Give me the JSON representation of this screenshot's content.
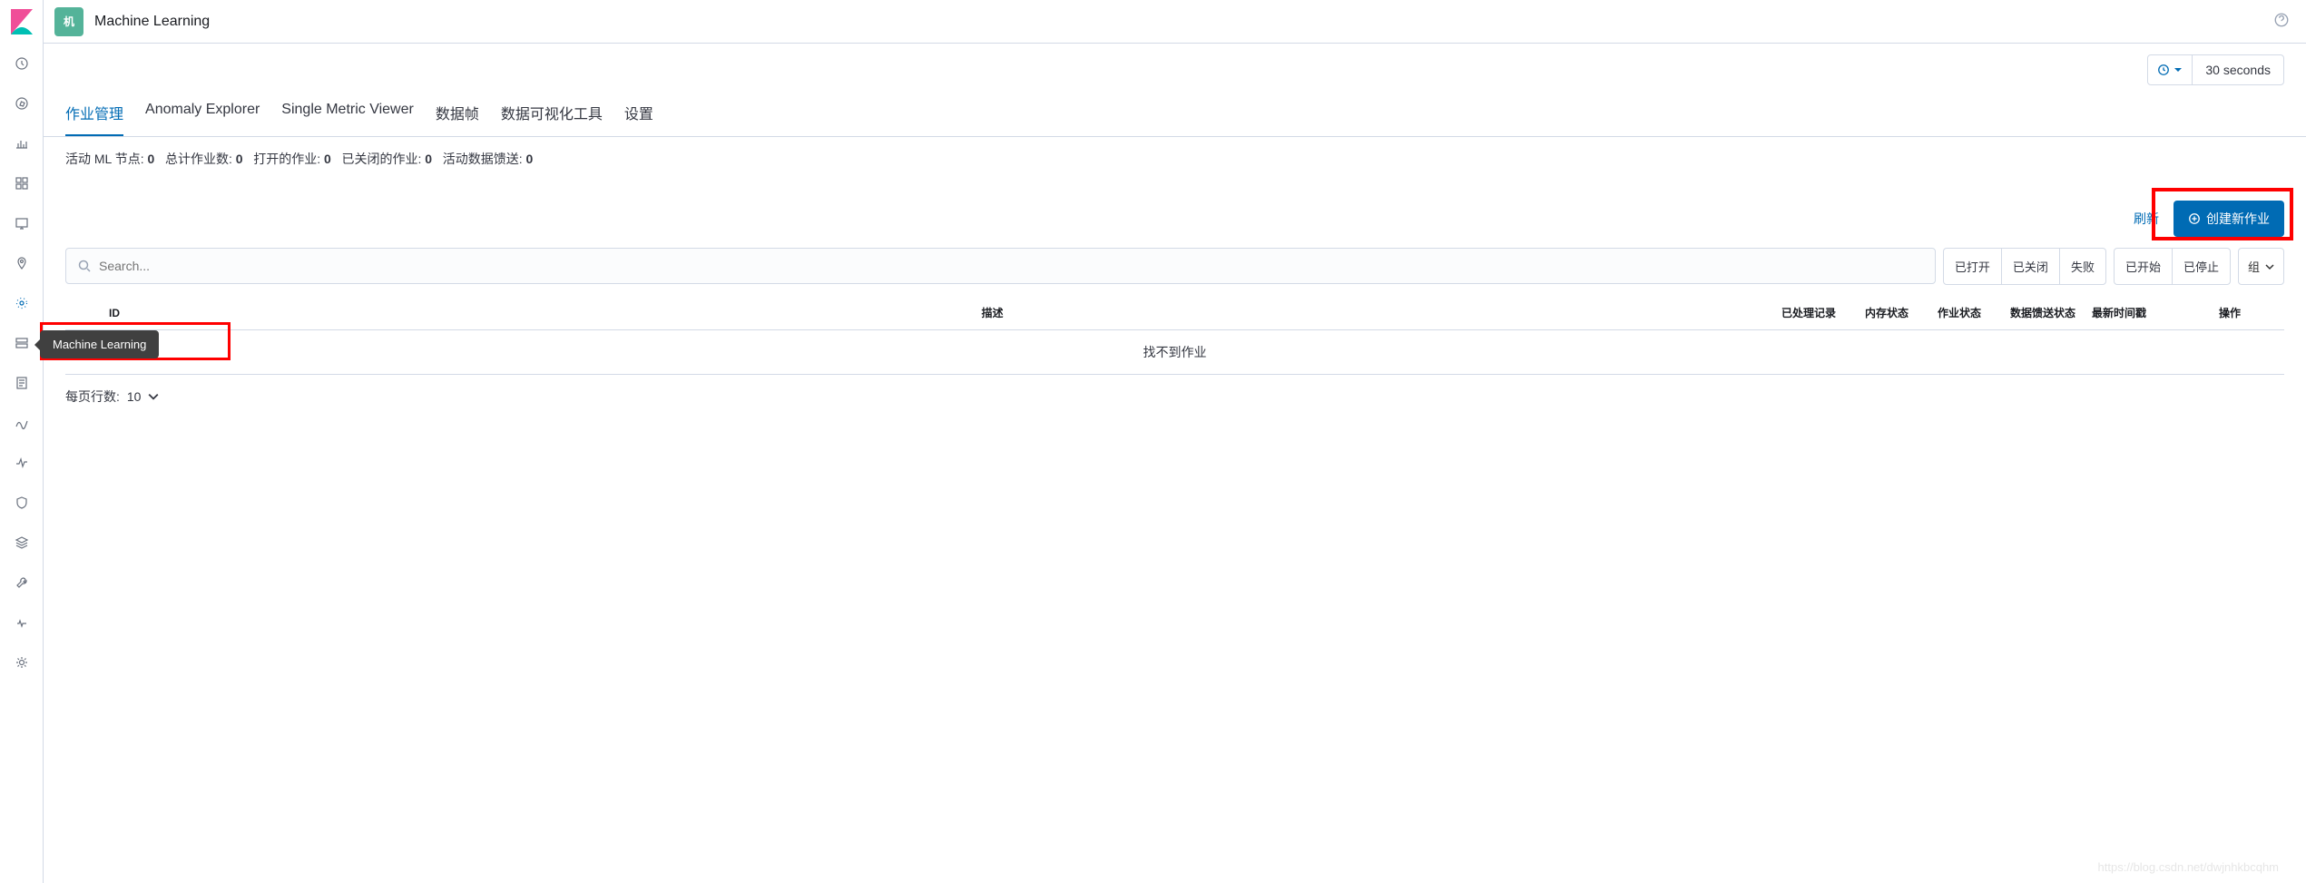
{
  "app": {
    "badge_text": "机",
    "title": "Machine Learning",
    "tooltip": "Machine Learning"
  },
  "refresh": {
    "interval": "30 seconds"
  },
  "tabs": {
    "job_mgmt": "作业管理",
    "anomaly": "Anomaly Explorer",
    "single_metric": "Single Metric Viewer",
    "dataframe": "数据帧",
    "datavis": "数据可视化工具",
    "settings": "设置"
  },
  "stats": {
    "nodes_label": "活动 ML 节点:",
    "nodes_val": "0",
    "total_label": "总计作业数:",
    "total_val": "0",
    "open_label": "打开的作业:",
    "open_val": "0",
    "closed_label": "已关闭的作业:",
    "closed_val": "0",
    "feed_label": "活动数据馈送:",
    "feed_val": "0"
  },
  "actions": {
    "refresh": "刷新",
    "create": "创建新作业"
  },
  "search": {
    "placeholder": "Search..."
  },
  "filters": {
    "opened": "已打开",
    "closed": "已关闭",
    "failed": "失败",
    "started": "已开始",
    "stopped": "已停止",
    "group": "组"
  },
  "columns": {
    "id": "ID",
    "desc": "描述",
    "processed": "已处理记录",
    "memory": "内存状态",
    "job": "作业状态",
    "feed": "数据馈送状态",
    "latest": "最新时间戳",
    "ops": "操作"
  },
  "table": {
    "empty": "找不到作业"
  },
  "pager": {
    "label": "每页行数:",
    "value": "10"
  },
  "watermark": "https://blog.csdn.net/dwjnhkbcqhm"
}
